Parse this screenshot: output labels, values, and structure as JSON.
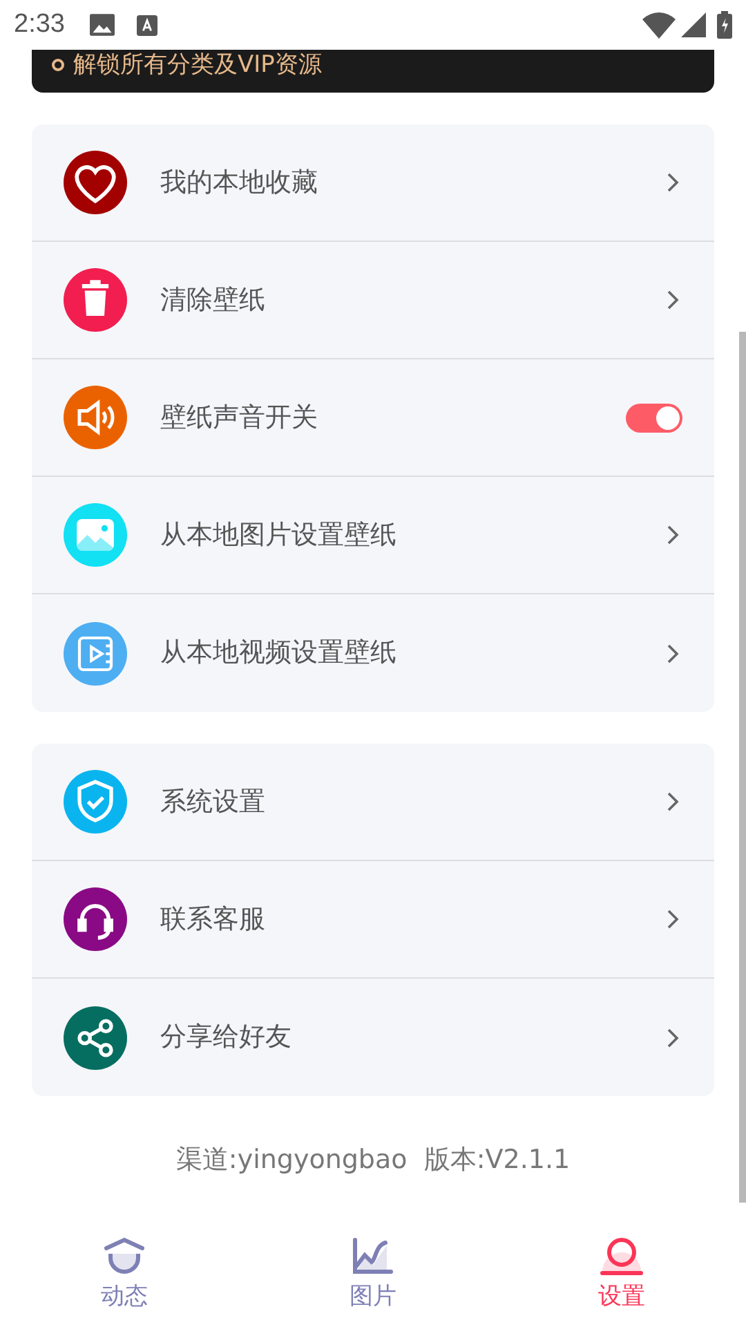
{
  "status_bar": {
    "time": "2:33"
  },
  "banner": {
    "text": "解锁所有分类及VIP资源"
  },
  "groups": [
    {
      "items": [
        {
          "kind": "link",
          "label": "我的本地收藏",
          "color": "#a30000"
        },
        {
          "kind": "link",
          "label": "清除壁纸",
          "color": "#f21e4f"
        },
        {
          "kind": "toggle",
          "label": "壁纸声音开关",
          "color": "#ea6200",
          "on": true
        },
        {
          "kind": "link",
          "label": "从本地图片设置壁纸",
          "color": "#12e0f3"
        },
        {
          "kind": "link",
          "label": "从本地视频设置壁纸",
          "color": "#4eaef2"
        }
      ]
    },
    {
      "items": [
        {
          "kind": "link",
          "label": "系统设置",
          "color": "#0ab4ef"
        },
        {
          "kind": "link",
          "label": "联系客服",
          "color": "#8a0a85"
        },
        {
          "kind": "link",
          "label": "分享给好友",
          "color": "#066e60"
        }
      ]
    }
  ],
  "version": "渠道:yingyongbao  版本:V2.1.1",
  "tabs": [
    {
      "label": "动态",
      "selected": false
    },
    {
      "label": "图片",
      "selected": false
    },
    {
      "label": "设置",
      "selected": true
    }
  ]
}
